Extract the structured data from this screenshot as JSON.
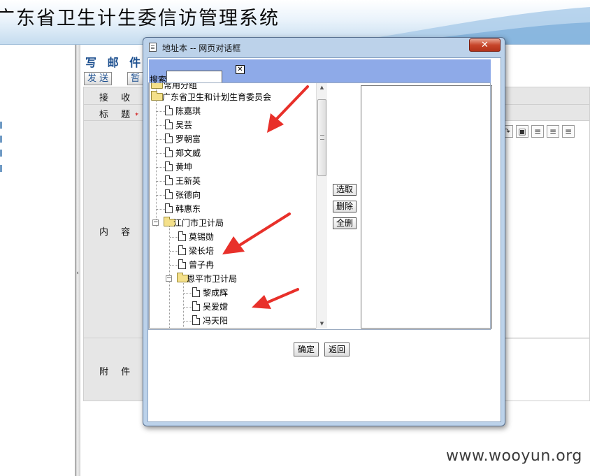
{
  "app": {
    "title": "广东省卫生计生委信访管理系统"
  },
  "compose": {
    "title": "写 邮 件",
    "send_label": "发 送",
    "draft_label": "暂",
    "to_label": "接 收 者",
    "subject_label": "标   题",
    "content_label": "内   容",
    "attach_label": "附   件",
    "required_mark": "*"
  },
  "dialog": {
    "title": "地址本 -- 网页对话框",
    "close_glyph": "✕",
    "search": {
      "label": "搜索",
      "value": "",
      "placeholder": ""
    },
    "tree": [
      {
        "label": "常用分组",
        "type": "folder"
      },
      {
        "label": "广东省卫生和计划生育委员会",
        "type": "folder"
      },
      {
        "label": "陈嘉琪",
        "type": "person"
      },
      {
        "label": "吴芸",
        "type": "person"
      },
      {
        "label": "罗朝富",
        "type": "person"
      },
      {
        "label": "郑文威",
        "type": "person"
      },
      {
        "label": "黄坤",
        "type": "person"
      },
      {
        "label": "王新英",
        "type": "person"
      },
      {
        "label": "张德向",
        "type": "person"
      },
      {
        "label": "韩惠东",
        "type": "person"
      },
      {
        "label": "江门市卫计局",
        "type": "folder",
        "expanded": true
      },
      {
        "label": "莫锡勋",
        "type": "person"
      },
      {
        "label": "梁长培",
        "type": "person"
      },
      {
        "label": "曾子冉",
        "type": "person"
      },
      {
        "label": "恩平市卫计局",
        "type": "folder",
        "expanded": true
      },
      {
        "label": "黎成辉",
        "type": "person"
      },
      {
        "label": "吴爱嫦",
        "type": "person"
      },
      {
        "label": "冯天阳",
        "type": "person"
      }
    ],
    "buttons": {
      "select": "选取",
      "delete": "删除",
      "delete_all": "全删",
      "ok": "确定",
      "back": "返回"
    }
  },
  "watermark": "www.wooyun.org",
  "colors": {
    "annotation_arrow": "#e8302a",
    "search_bar": "#8eaae8",
    "dialog_frame": "#bcd2ea",
    "compose_title": "#1c4f8f"
  }
}
